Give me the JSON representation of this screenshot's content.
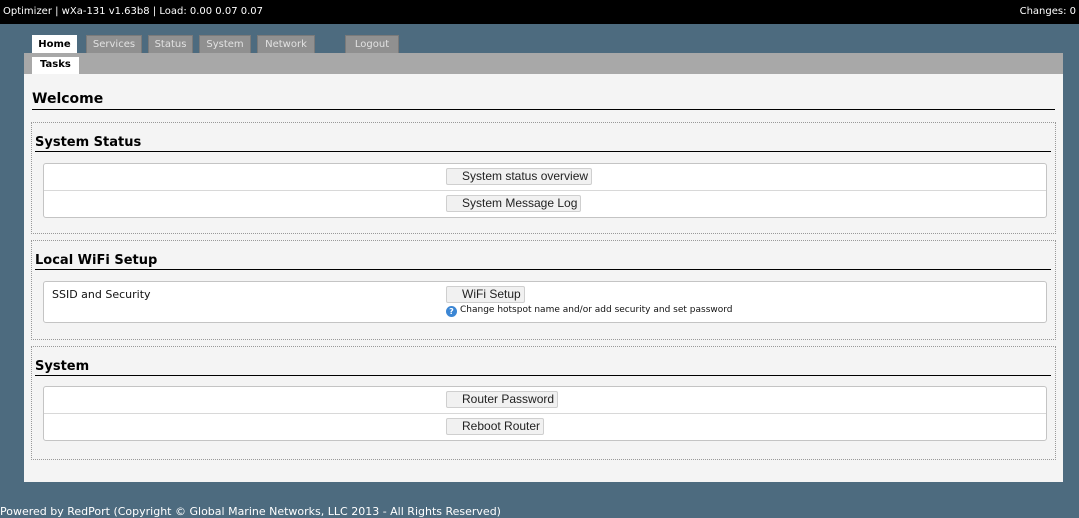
{
  "topbar": {
    "status_text": "Optimizer | wXa-131 v1.63b8 | Load: 0.00 0.07 0.07",
    "changes_text": "Changes: 0"
  },
  "nav": {
    "tabs": [
      {
        "label": "Home",
        "active": true
      },
      {
        "label": "Services",
        "active": false
      },
      {
        "label": "Status",
        "active": false
      },
      {
        "label": "System",
        "active": false
      },
      {
        "label": "Network",
        "active": false
      },
      {
        "label": "Logout",
        "active": false
      }
    ],
    "subtabs": [
      {
        "label": "Tasks",
        "active": true
      }
    ]
  },
  "main": {
    "title": "Welcome",
    "sections": [
      {
        "title": "System Status",
        "rows": [
          {
            "label": "",
            "button": "System status overview"
          },
          {
            "label": "",
            "button": "System Message Log"
          }
        ]
      },
      {
        "title": "Local WiFi Setup",
        "rows": [
          {
            "label": "SSID and Security",
            "button": "WiFi Setup",
            "help": "Change hotspot name and/or add security and set password",
            "help_icon": "help-icon"
          }
        ]
      },
      {
        "title": "System",
        "rows": [
          {
            "label": "",
            "button": "Router Password"
          },
          {
            "label": "",
            "button": "Reboot Router"
          }
        ]
      }
    ]
  },
  "footer": {
    "text": "Powered by RedPort (Copyright © Global Marine Networks, LLC 2013 - All Rights Reserved)"
  }
}
